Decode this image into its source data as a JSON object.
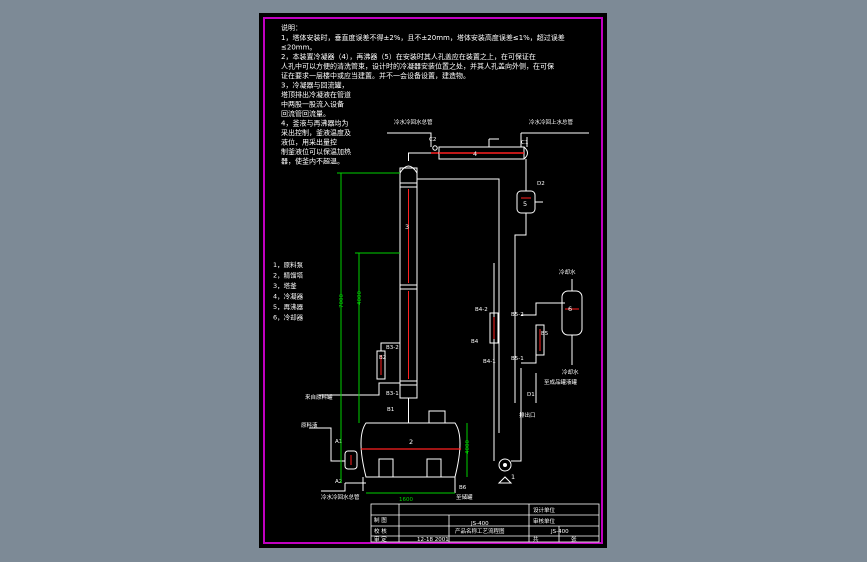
{
  "notes": {
    "heading": "说明：",
    "lines": [
      "1，塔体安装时，垂直度误差不得±2%，且不±20mm，塔体安装高度误差≤1%，超过误差",
      "≤20mm。",
      "2，本装置冷凝器（4），再沸器（5）在安装时其人孔盖应在装置之上，在可保证在",
      "人孔中可以方便的清洗管束，设计时的冷凝器安装位置之处，并其人孔盖向外侧，在可保",
      "证在要求一层楼中或应当建置。并不一会设备设置，建造物。",
      "3，冷凝器与回流罐，",
      "塔顶排出冷凝液在管道",
      "中两股一股流入设备",
      "回流管回流量。",
      "4，釜液与再沸器均为",
      "采出控制，釜液温度及",
      "液位，用采出量控",
      "制釜液位可以保温加热",
      "器，使釜内不超温。"
    ]
  },
  "legend": [
    "1，原料泵",
    "2，精馏塔",
    "3，塔釜",
    "4，冷凝器",
    "5，再沸器",
    "6，冷却器"
  ],
  "callouts": {
    "n1": "1",
    "n2": "2",
    "n3": "3",
    "n4": "4",
    "n5": "5",
    "n6": "6",
    "c1": "C1",
    "c2": "C2",
    "d1": "D1",
    "d2": "D2",
    "a1": "A1",
    "a2": "A2",
    "b1": "B1",
    "b2": "B2",
    "b3_1": "B3-1",
    "b3_2": "B3-2",
    "b4": "B4",
    "b4_1": "B4-1",
    "b4_2": "B4-2",
    "b5": "B5",
    "b5_1": "B5-1",
    "b5_2": "B5-2",
    "b6": "B6"
  },
  "dimensions": {
    "d4000": "4000",
    "d7000": "7000",
    "d4000b": "4000",
    "d1600": "1600"
  },
  "streams": {
    "cool_return_left": "冷水冷回水总管",
    "cool_return_right": "冷水冷回上水总管",
    "cool_water_top": "冷却水",
    "cool_water_bottom": "冷却水",
    "from_feed": "来自原料罐",
    "to_product": "至成品罐液罐",
    "feed_tank": "原料液",
    "to_tank": "至储罐",
    "discharge": "排出口",
    "bottom_main": "冷水冷回水总管"
  },
  "title_block": {
    "code1": "JS-400",
    "code2": "JS-400",
    "title": "产品名称工艺流程图",
    "company1": "设计单位",
    "company2": "审核单位",
    "date": "12-18 2001",
    "r1": "制 图",
    "r2": "校 核",
    "r3": "审 定",
    "r4": "比 例",
    "r5": "图 号",
    "r6": "阶 段",
    "r7": "共",
    "r8": "张"
  },
  "colors": {
    "sheet": "#000000",
    "border": "#c000c0",
    "line": "#ffffff",
    "pipe_red": "#ff2020",
    "dim_green": "#00d000",
    "background": "#7d8a96"
  }
}
